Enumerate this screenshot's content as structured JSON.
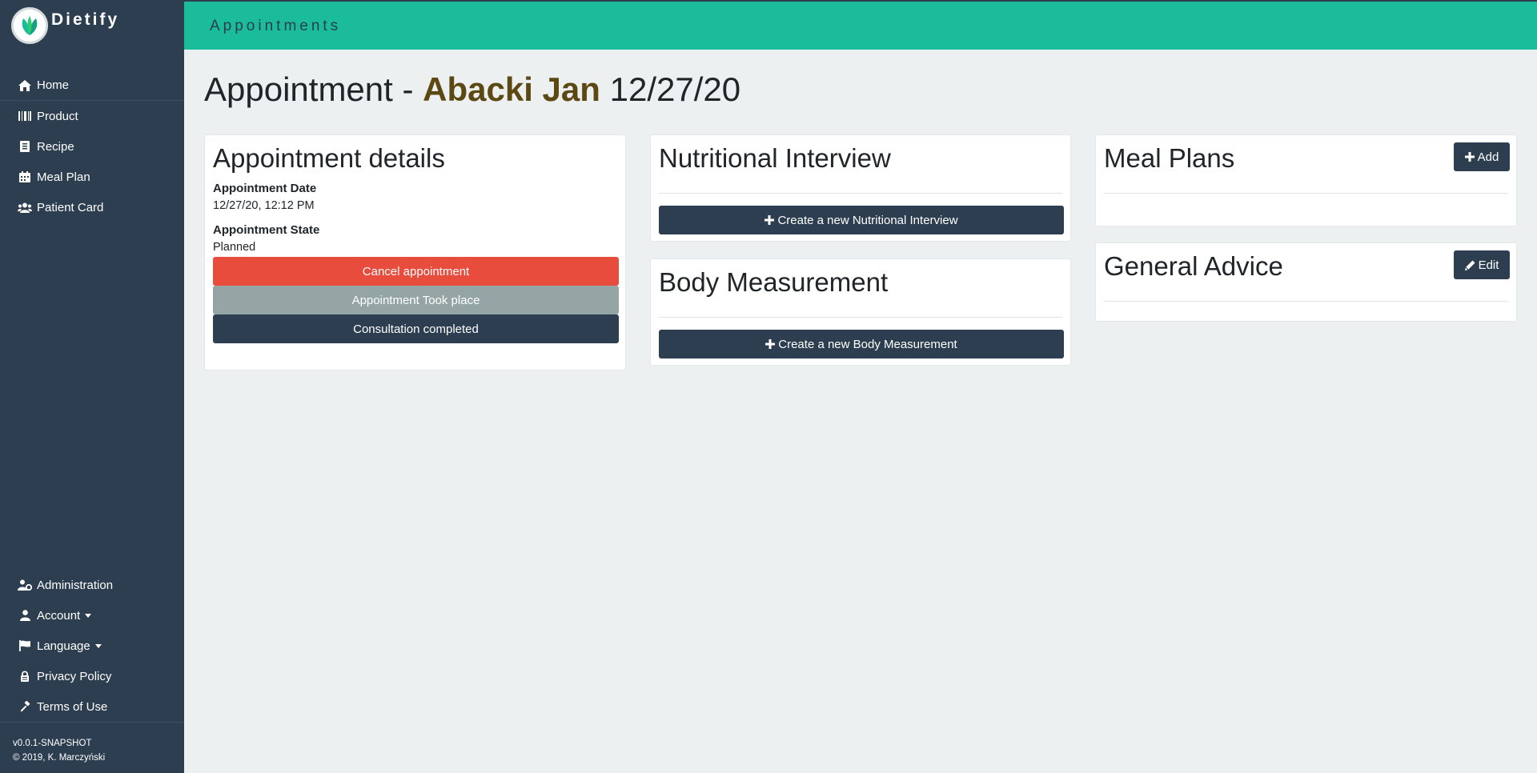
{
  "app": {
    "name": "Dietify",
    "logo_icon": "leaf-logo-icon",
    "brand_color": "#1abc9c",
    "sidebar_color": "#2c3e50"
  },
  "sidebar": {
    "top_items": [
      {
        "label": "Home",
        "icon": "home-icon"
      },
      {
        "label": "Product",
        "icon": "barcode-icon"
      },
      {
        "label": "Recipe",
        "icon": "book-icon"
      },
      {
        "label": "Meal Plan",
        "icon": "calendar-icon"
      },
      {
        "label": "Patient Card",
        "icon": "users-icon"
      }
    ],
    "bottom_items": [
      {
        "label": "Administration",
        "icon": "user-cog-icon"
      },
      {
        "label": "Account",
        "icon": "user-icon",
        "dropdown": true
      },
      {
        "label": "Language",
        "icon": "flag-icon",
        "dropdown": true
      },
      {
        "label": "Privacy Policy",
        "icon": "lock-icon"
      },
      {
        "label": "Terms of Use",
        "icon": "gavel-icon"
      }
    ],
    "version": "v0.0.1-SNAPSHOT",
    "copyright": "© 2019, K. Marczyński"
  },
  "topbar": {
    "title": "Appointments"
  },
  "page": {
    "heading_prefix": "Appointment -",
    "patient_name": "Abacki Jan",
    "date": "12/27/20"
  },
  "details_card": {
    "title": "Appointment details",
    "date_label": "Appointment Date",
    "date_value": "12/27/20, 12:12 PM",
    "state_label": "Appointment State",
    "state_value": "Planned",
    "cancel_button": "Cancel appointment",
    "took_place_button": "Appointment Took place",
    "completed_button": "Consultation completed",
    "cancel_color": "#e74c3c",
    "took_place_color": "#95a5a6"
  },
  "interview_card": {
    "title": "Nutritional Interview",
    "create_button": "Create a new Nutritional Interview",
    "create_icon": "plus-icon"
  },
  "measurement_card": {
    "title": "Body Measurement",
    "create_button": "Create a new Body Measurement",
    "create_icon": "plus-icon"
  },
  "meal_plans_card": {
    "title": "Meal Plans",
    "add_button": "Add",
    "add_icon": "plus-icon"
  },
  "advice_card": {
    "title": "General Advice",
    "edit_button": "Edit",
    "edit_icon": "pencil-icon"
  }
}
